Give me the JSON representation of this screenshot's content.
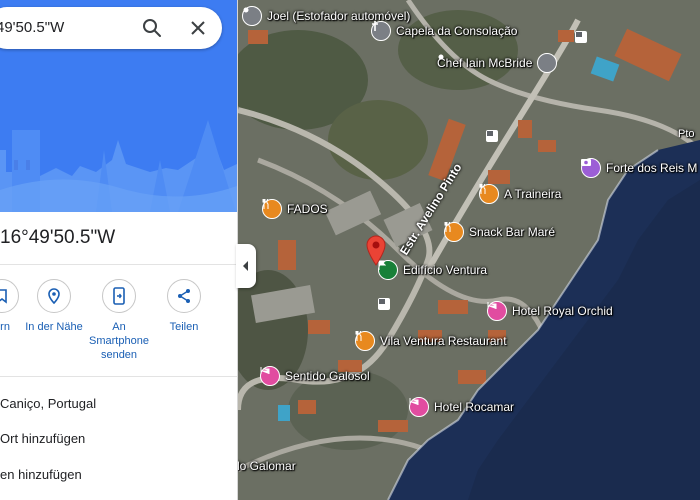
{
  "search": {
    "query": "49'50.5\"W"
  },
  "place": {
    "coordinates": "16°49'50.5\"W"
  },
  "actions": [
    {
      "label": "ern",
      "icon": "save-icon"
    },
    {
      "label": "In der Nähe",
      "icon": "nearby-icon"
    },
    {
      "label": "An Smartphone senden",
      "icon": "send-to-phone-icon"
    },
    {
      "label": "Teilen",
      "icon": "share-icon"
    }
  ],
  "info": {
    "address": "Caniço, Portugal",
    "add_place": "Ort hinzufügen",
    "add_label": "en hinzufügen"
  },
  "map": {
    "road_label": "Estr. Avelino Pinto",
    "pois": {
      "joel": "Joel (Estofador automóvel)",
      "capela": "Capela da Consolação",
      "chef": "Chef Iain McBride",
      "forte": "Forte dos Reis M",
      "fados": "FADOS",
      "traineira": "A Traineira",
      "snackbar": "Snack Bar Maré",
      "edificio": "Edifício Ventura",
      "royal": "Hotel Royal Orchid",
      "vila": "Vila Ventura Restaurant",
      "sentido": "Sentido Galosol",
      "rocamar": "Hotel Rocamar",
      "galomar": "do Galomar",
      "edge": "Pto"
    }
  },
  "colors": {
    "brand_blue": "#3d7cf2",
    "link_blue": "#1a5fb4",
    "restaurant_orange": "#e8891f",
    "hotel_pink": "#e14ca0",
    "landmark_purple": "#9c5ed6",
    "place_green": "#188038",
    "pin_red": "#ea4335"
  }
}
